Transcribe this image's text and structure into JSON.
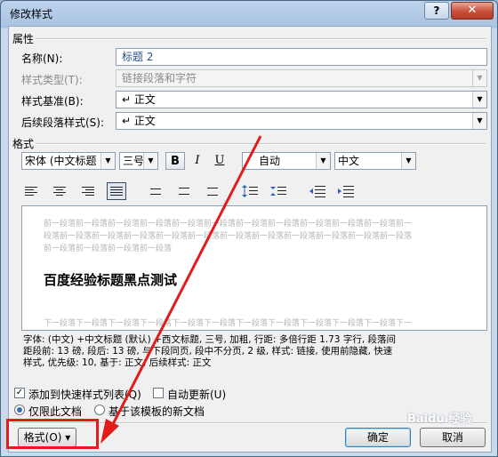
{
  "window": {
    "title": "修改样式",
    "help": "?",
    "close": "✕"
  },
  "properties": {
    "section": "属性",
    "name_label": "名称(N):",
    "name_value": "标题 2",
    "type_label": "样式类型(T):",
    "type_value": "链接段落和字符",
    "based_label": "样式基准(B):",
    "based_value": "↵ 正文",
    "next_label": "后续段落样式(S):",
    "next_value": "↵ 正文"
  },
  "format": {
    "section": "格式",
    "font": "宋体 (中文标题",
    "size": "三号",
    "bold": "B",
    "italic": "I",
    "underline": "U",
    "color": "自动",
    "script": "中文"
  },
  "preview": {
    "prev_lines": [
      "前一段落前一段落前一段落前一段落前一段落前一段落前一段落前一段落前一段落前一段落前一段落前一",
      "段落前一段落前一段落前一段落前一段落前一段落前一段落前一段落前一段落前一段落前一段落前一段落",
      "前一段落前一段落前一段落前一段落"
    ],
    "sample": "百度经验标题黑点测试",
    "next_line": "下一段落下一段落下一段落下一段落下一段落下一段落下一段落下一段落下一段落下一段落下一段落下一"
  },
  "description": [
    "字体: (中文) +中文标题 (默认) +西文标题, 三号, 加粗, 行距: 多倍行距 1.73 字行, 段落间",
    "距段前: 13 磅, 段后: 13 磅, 与下段同页, 段中不分页, 2 级, 样式: 链接, 使用前隐藏, 快速",
    "样式, 优先级: 10, 基于: 正文, 后续样式: 正文"
  ],
  "options": {
    "add_quick": "添加到快速样式列表(Q)",
    "auto_update": "自动更新(U)",
    "only_doc": "仅限此文档",
    "template": "基于该模板的新文档"
  },
  "buttons": {
    "format": "格式(O) ▾",
    "ok": "确定",
    "cancel": "取消"
  },
  "watermark": "Baidu 经验",
  "colors": {
    "annotation_red": "#e31b1b"
  }
}
